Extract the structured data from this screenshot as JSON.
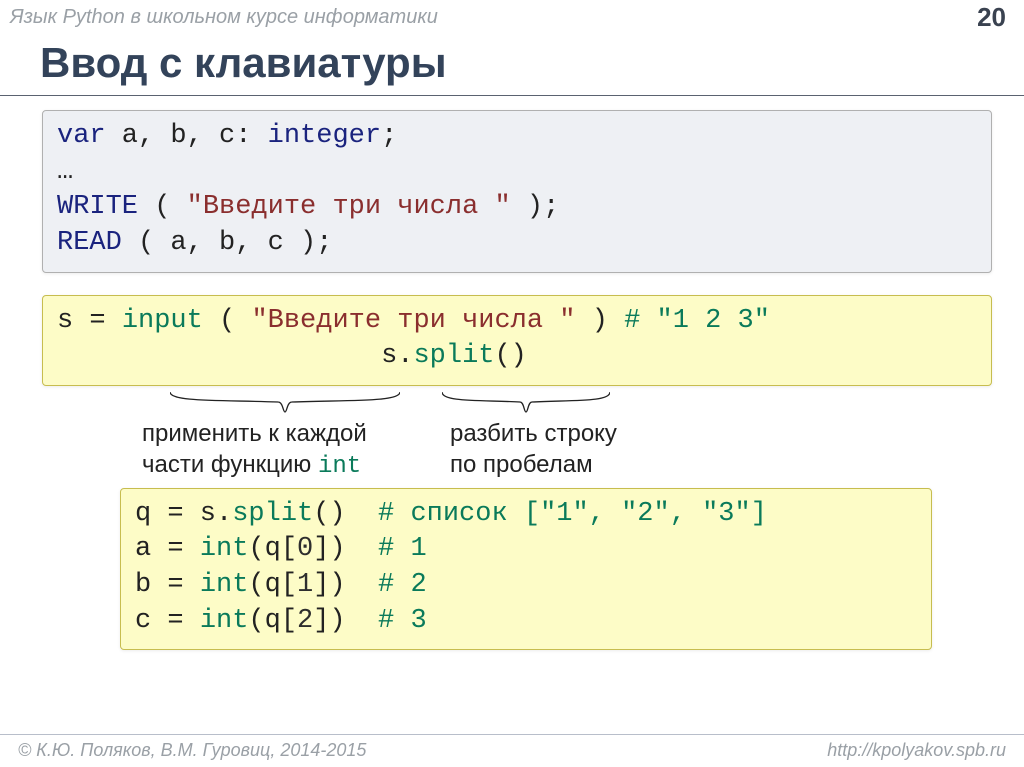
{
  "header": {
    "subtitle": "Язык Python в школьном курсе информатики",
    "page_number": "20"
  },
  "title": "Ввод с клавиатуры",
  "code1": {
    "l1_var": "var",
    "l1_rest": " a, b, c: ",
    "l1_int": "integer",
    "l1_end": ";",
    "l2": "…",
    "l3_kw": "WRITE",
    "l3_open": " ( ",
    "l3_str": "\"Введите три числа \"",
    "l3_close": " );",
    "l4_kw": "READ",
    "l4_rest": " ( a, b, c );"
  },
  "code2": {
    "l1_a": "s = ",
    "l1_input": "input",
    "l1_b": " ( ",
    "l1_str": "\"Введите три числа \"",
    "l1_c": " ) ",
    "l1_cmt": "# \"1 2 3\"",
    "l2_indent": "                    ",
    "l2_a": "s.",
    "l2_split": "split",
    "l2_b": "()"
  },
  "anno": {
    "left_l1": "применить к каждой",
    "left_l2_a": "части функцию ",
    "left_l2_b": "int",
    "right_l1": "разбить строку",
    "right_l2": "по пробелам"
  },
  "code3": {
    "l1_a": "q = s.",
    "l1_split": "split",
    "l1_b": "()  ",
    "l1_cmt": "# список [\"1\", \"2\", \"3\"]",
    "l2_a": "a = ",
    "l2_int": "int",
    "l2_b": "(q[",
    "l2_idx": "0",
    "l2_c": "])  ",
    "l2_cmt": "# 1",
    "l3_a": "b = ",
    "l3_int": "int",
    "l3_b": "(q[",
    "l3_idx": "1",
    "l3_c": "])  ",
    "l3_cmt": "# 2",
    "l4_a": "c = ",
    "l4_int": "int",
    "l4_b": "(q[",
    "l4_idx": "2",
    "l4_c": "])  ",
    "l4_cmt": "# 3"
  },
  "footer": {
    "left": "© К.Ю. Поляков, В.М. Гуровиц, 2014-2015",
    "right": "http://kpolyakov.spb.ru"
  }
}
